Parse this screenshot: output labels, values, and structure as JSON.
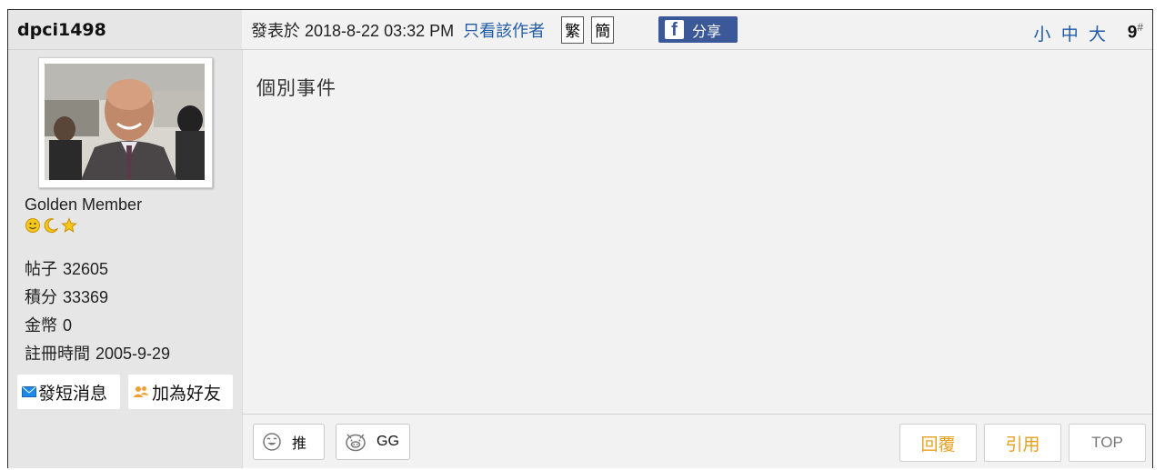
{
  "user": {
    "name": "dpci1498",
    "rank": "Golden Member",
    "stats": [
      {
        "label": "帖子",
        "value": "32605"
      },
      {
        "label": "積分",
        "value": "33369"
      },
      {
        "label": "金幣",
        "value": "0"
      },
      {
        "label": "註冊時間",
        "value": "2005-9-29"
      }
    ],
    "pm_label": "發短消息",
    "friend_label": "加為好友"
  },
  "post": {
    "posted_at": "發表於 2018-8-22 03:32 PM",
    "only_author": "只看該作者",
    "traditional": "繁",
    "simplified": "簡",
    "share_label": "分享",
    "font_small": "小",
    "font_medium": "中",
    "font_large": "大",
    "floor_number": "9",
    "floor_mark": "#",
    "content": "個別事件"
  },
  "reactions": {
    "push_label": "推",
    "gg_label": "GG"
  },
  "actions": {
    "reply": "回覆",
    "quote": "引用",
    "top": "TOP"
  },
  "colors": {
    "link": "#1f5ba8",
    "facebook": "#3b5998",
    "action_orange": "#e8a020"
  }
}
